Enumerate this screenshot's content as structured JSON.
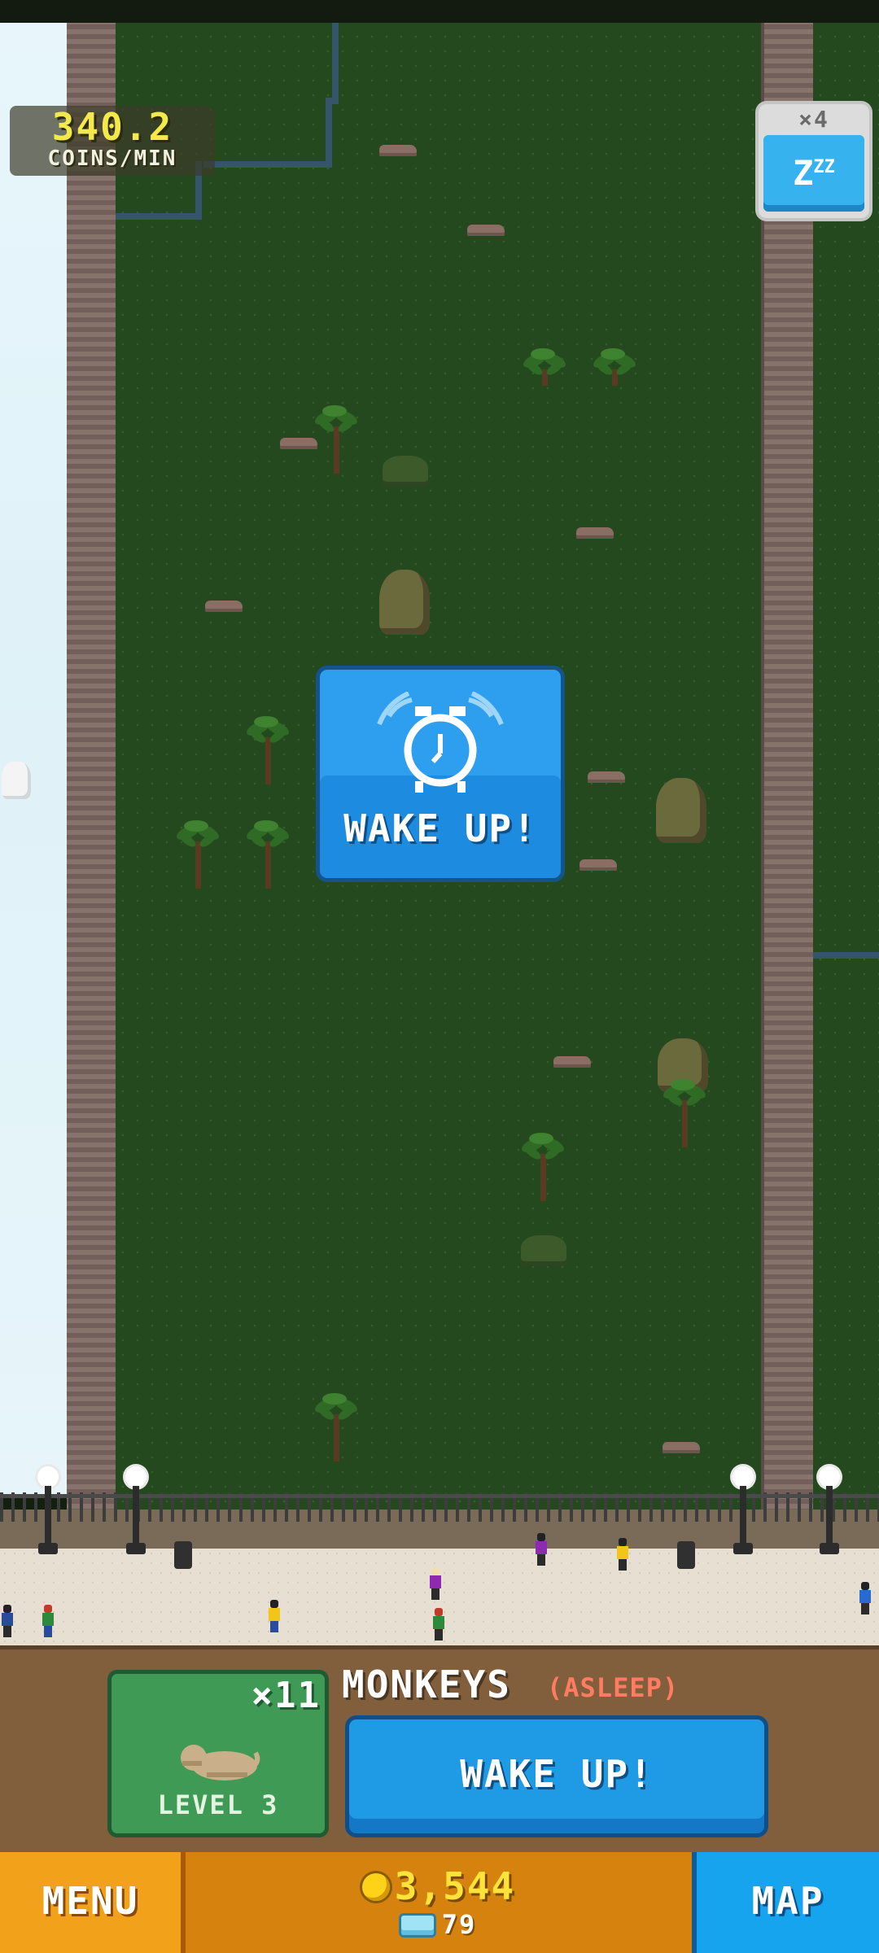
{
  "hud": {
    "coins_per_min_value": "340.2",
    "coins_per_min_label": "COINS/MIN",
    "sleep_multiplier": "×4",
    "sleep_icon": "zzz-icon"
  },
  "center_prompt": {
    "label": "WAKE UP!",
    "icon": "alarm-clock-icon"
  },
  "exhibit": {
    "multiplier": "×11",
    "level": "LEVEL 3",
    "name": "MONKEYS",
    "status": "(ASLEEP)",
    "wake_label": "WAKE UP!"
  },
  "bottom_bar": {
    "menu_label": "MENU",
    "map_label": "MAP",
    "coins": "3,544",
    "gems": "79"
  },
  "colors": {
    "grass": "#25491f",
    "primary_blue": "#1f9be6",
    "menu_orange": "#f2a11a",
    "coin_yellow": "#ffe33a",
    "status_red": "#ff7b62"
  }
}
